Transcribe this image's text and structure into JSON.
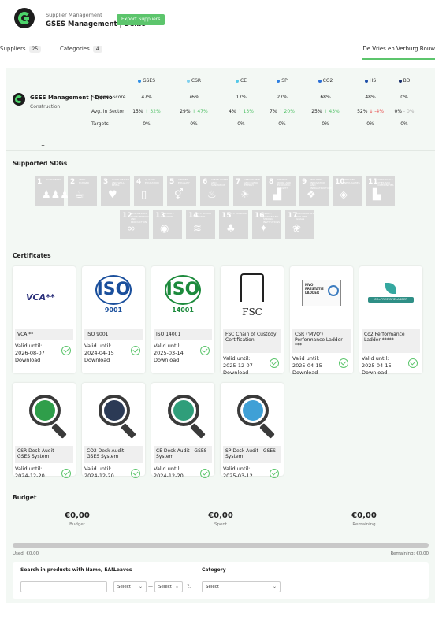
{
  "header": {
    "small_title": "Supplier Management",
    "title": "GSES Management | Demo",
    "export_label": "Export Suppliers"
  },
  "tabs": {
    "suppliers_label": "Suppliers",
    "suppliers_count": "25",
    "categories_label": "Categories",
    "categories_count": "4",
    "active_label": "De Vries en Verburg Bouw"
  },
  "company": {
    "name": "GSES Management | Demo",
    "sector": "Construction"
  },
  "score_rows": [
    "Supplier Score",
    "Avg. in Sector",
    "Targets"
  ],
  "score_columns": [
    {
      "name": "GSES",
      "color": "#2f8fe6",
      "score": "47%",
      "avg": "15%",
      "delta": "32%",
      "dir": "up",
      "target": "0%"
    },
    {
      "name": "CSR",
      "color": "#7fd0ee",
      "score": "76%",
      "avg": "29%",
      "delta": "47%",
      "dir": "up",
      "target": "0%"
    },
    {
      "name": "CE",
      "color": "#54c8e8",
      "score": "17%",
      "avg": "4%",
      "delta": "13%",
      "dir": "up",
      "target": "0%"
    },
    {
      "name": "SP",
      "color": "#2f7fe0",
      "score": "27%",
      "avg": "7%",
      "delta": "20%",
      "dir": "up",
      "target": "0%"
    },
    {
      "name": "CO2",
      "color": "#2c6fd6",
      "score": "68%",
      "avg": "25%",
      "delta": "43%",
      "dir": "up",
      "target": "0%"
    },
    {
      "name": "HS",
      "color": "#1f4fa8",
      "score": "48%",
      "avg": "52%",
      "delta": "-4%",
      "dir": "down",
      "target": "0%"
    },
    {
      "name": "BD",
      "color": "#1a2f6a",
      "score": "0%",
      "avg": "0%",
      "delta": "0%",
      "dir": "none",
      "target": "0%"
    }
  ],
  "ellipsis": "...",
  "sdg_title": "Supported SDGs",
  "sdgs": [
    {
      "num": "1",
      "label": "NO POVERTY",
      "icon": "people-icon",
      "glyph": "♟♟♟"
    },
    {
      "num": "2",
      "label": "ZERO HUNGER",
      "icon": "bowl-icon",
      "glyph": "☕"
    },
    {
      "num": "3",
      "label": "GOOD HEALTH AND WELL-BEING",
      "icon": "heartbeat-icon",
      "glyph": "♥"
    },
    {
      "num": "4",
      "label": "QUALITY EDUCATION",
      "icon": "book-icon",
      "glyph": "▯"
    },
    {
      "num": "5",
      "label": "GENDER EQUALITY",
      "icon": "gender-icon",
      "glyph": "⚥"
    },
    {
      "num": "6",
      "label": "CLEAN WATER AND SANITATION",
      "icon": "water-icon",
      "glyph": "♨"
    },
    {
      "num": "7",
      "label": "AFFORDABLE AND CLEAN ENERGY",
      "icon": "sun-icon",
      "glyph": "☀"
    },
    {
      "num": "8",
      "label": "DECENT WORK AND ECONOMIC GROWTH",
      "icon": "growth-icon",
      "glyph": "▟"
    },
    {
      "num": "9",
      "label": "INDUSTRY, INNOVATION AND INFRASTRUCTURE",
      "icon": "cube-icon",
      "glyph": "❖"
    },
    {
      "num": "10",
      "label": "REDUCED INEQUALITIES",
      "icon": "equal-icon",
      "glyph": "◈"
    },
    {
      "num": "11",
      "label": "SUSTAINABLE CITIES AND COMMUNITIES",
      "icon": "city-icon",
      "glyph": "▙"
    },
    {
      "num": "12",
      "label": "RESPONSIBLE CONSUMPTION AND PRODUCTION",
      "icon": "infinity-icon",
      "glyph": "∞"
    },
    {
      "num": "13",
      "label": "CLIMATE ACTION",
      "icon": "eye-icon",
      "glyph": "◉"
    },
    {
      "num": "14",
      "label": "LIFE BELOW WATER",
      "icon": "fish-icon",
      "glyph": "≋"
    },
    {
      "num": "15",
      "label": "LIFE ON LAND",
      "icon": "tree-icon",
      "glyph": "♣"
    },
    {
      "num": "16",
      "label": "PEACE, JUSTICE AND STRONG INSTITUTIONS",
      "icon": "dove-icon",
      "glyph": "✦"
    },
    {
      "num": "17",
      "label": "PARTNERSHIPS FOR THE GOALS",
      "icon": "flower-icon",
      "glyph": "❀"
    }
  ],
  "cert_title": "Certificates",
  "valid_prefix": "Valid until:",
  "download_label": "Download",
  "certificates": [
    {
      "name": "VCA **",
      "valid": "2026-08-07",
      "download": true,
      "logo": "vca-logo",
      "logo_text": "VCA**"
    },
    {
      "name": "ISO 9001",
      "valid": "2024-04-15",
      "download": true,
      "logo": "iso-9001-logo",
      "logo_text": "ISO",
      "logo_sub": "9001"
    },
    {
      "name": "ISO 14001",
      "valid": "2025-03-14",
      "download": true,
      "logo": "iso-14001-logo",
      "logo_text": "ISO",
      "logo_sub": "14001"
    },
    {
      "name": "FSC Chain of Custody Certification",
      "valid": "2025-12-07",
      "download": true,
      "logo": "fsc-logo",
      "logo_text": "FSC"
    },
    {
      "name": "CSR ('MVO') Performance Ladder ***",
      "valid": "2025-04-15",
      "download": true,
      "logo": "mvo-logo",
      "logo_text": "MVO PRESTATIE LADDER"
    },
    {
      "name": "Co2 Performance Ladder *****",
      "valid": "2025-04-15",
      "download": true,
      "logo": "co2-ladder-logo",
      "logo_text": "CO₂-PRESTATIELADDER"
    },
    {
      "name": "CSR Desk Audit - GSES System",
      "valid": "2024-12-20",
      "download": false,
      "logo": "csr-audit-logo",
      "ring": "#2f9e4a"
    },
    {
      "name": "CO2 Desk Audit - GSES System",
      "valid": "2024-12-20",
      "download": false,
      "logo": "co2-audit-logo",
      "ring": "#2b3a55"
    },
    {
      "name": "CE Desk Audit - GSES System",
      "valid": "2024-12-20",
      "download": false,
      "logo": "ce-audit-logo",
      "ring": "#2f9e7a"
    },
    {
      "name": "SP Desk Audit - GSES System",
      "valid": "2025-03-12",
      "download": false,
      "logo": "sp-audit-logo",
      "ring": "#3fa0d6"
    }
  ],
  "budget": {
    "title": "Budget",
    "budget_value": "€0,00",
    "budget_label": "Budget",
    "spent_value": "€0,00",
    "spent_label": "Spent",
    "remaining_value": "€0,00",
    "remaining_label": "Remaining",
    "used_text": "Used: €0,00",
    "remaining_text": "Remaining: €0,00",
    "progress": 0
  },
  "filter": {
    "search_label": "Search in products with Name, EAN",
    "search_value": "",
    "leaves_label": "Leaves",
    "leaves_from": "Select",
    "leaves_sep": "—",
    "leaves_to": "Select",
    "category_label": "Category",
    "category_value": "Select"
  }
}
